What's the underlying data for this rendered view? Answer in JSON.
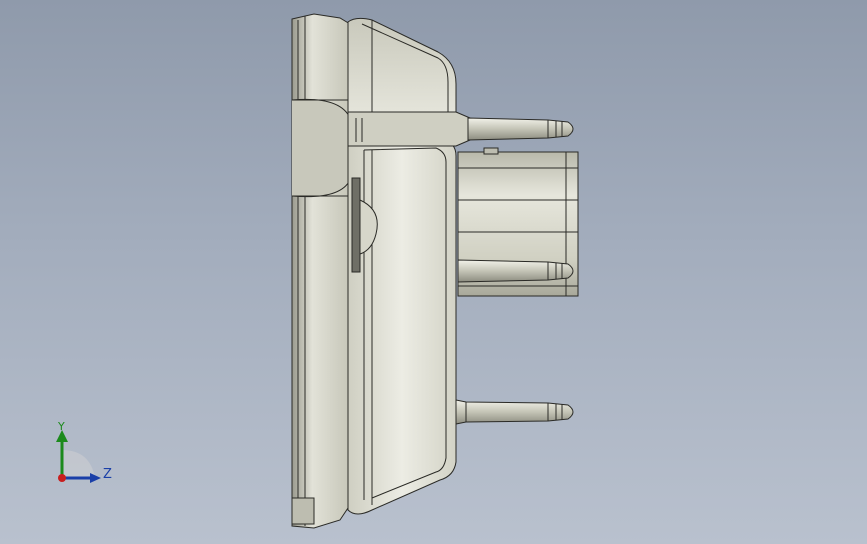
{
  "viewport": {
    "background_top": "#8f9aab",
    "background_bottom": "#b9c1ce",
    "model_fill": "#d9d9cd",
    "model_edge": "#2a2a26"
  },
  "triad": {
    "y_label": "Y",
    "z_label": "Z",
    "y_color": "#1c8a1c",
    "z_color": "#1a3fa8",
    "x_color": "#c81e1e"
  }
}
